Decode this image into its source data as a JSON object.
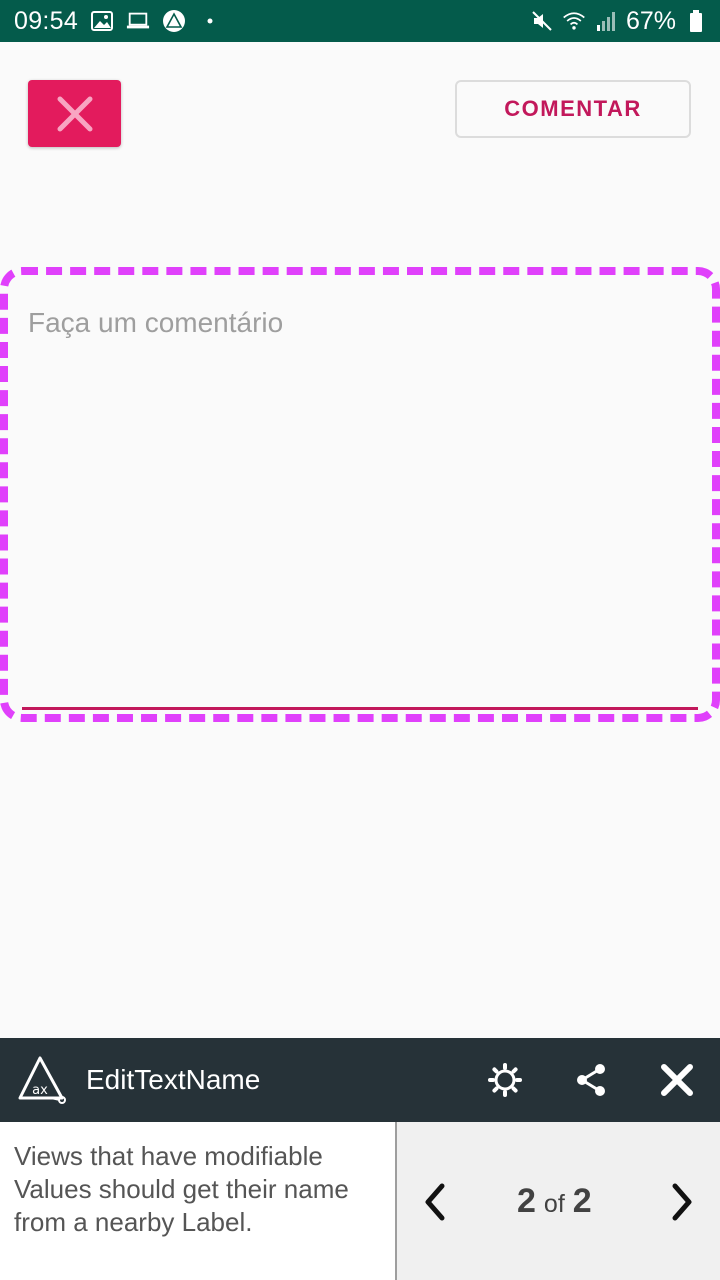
{
  "status_bar": {
    "time": "09:54",
    "battery": "67%",
    "icons": [
      "image-icon",
      "laptop-icon",
      "accessibility-scanner-icon",
      "dot-icon",
      "mute-icon",
      "wifi-icon",
      "signal-icon",
      "battery-icon"
    ]
  },
  "toolbar": {
    "close_icon": "close-icon",
    "comment_label": "COMENTAR"
  },
  "comment_field": {
    "placeholder": "Faça um comentário",
    "value": ""
  },
  "accessibility_panel": {
    "title": "EditTextName",
    "description": "Views that have modifiable Values should get their name from a nearby Label.",
    "current": "2",
    "of_label": "of",
    "total": "2",
    "icons": [
      "scanner-logo-icon",
      "settings-icon",
      "share-icon",
      "close-icon",
      "chevron-left-icon",
      "chevron-right-icon"
    ]
  },
  "colors": {
    "status_bar": "#045b4b",
    "accent": "#e31b5d",
    "highlight_border": "#e040fb",
    "panel_header": "#263238"
  }
}
